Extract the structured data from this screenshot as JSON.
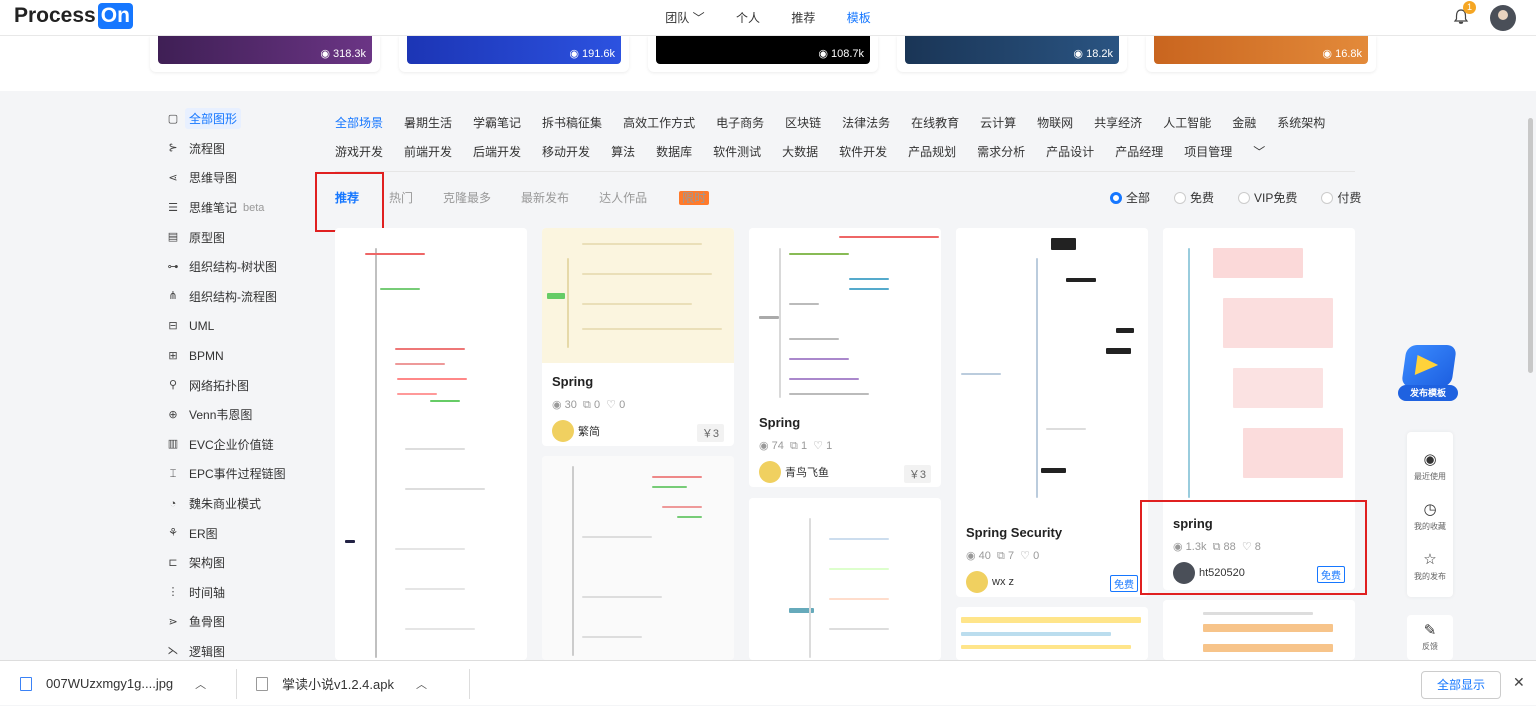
{
  "header": {
    "logo_text": "Process",
    "logo_badge": "On",
    "nav": [
      "团队 ﹀",
      "个人",
      "推荐",
      "模板"
    ],
    "notification_count": "1"
  },
  "banners": [
    {
      "views": "318.3k",
      "color": "#5a2d6e"
    },
    {
      "views": "191.6k",
      "color": "#2244cc"
    },
    {
      "views": "108.7k",
      "color": "#000000"
    },
    {
      "views": "18.2k",
      "color": "#1f3f66"
    },
    {
      "views": "16.8k",
      "color": "#d9792a"
    }
  ],
  "sidebar": {
    "items": [
      {
        "label": "全部图形",
        "icon": "all-shapes-icon",
        "glyph": "▢"
      },
      {
        "label": "流程图",
        "icon": "flowchart-icon",
        "glyph": "⊱"
      },
      {
        "label": "思维导图",
        "icon": "mindmap-icon",
        "glyph": "⋖"
      },
      {
        "label": "思维笔记",
        "icon": "notes-icon",
        "glyph": "☰",
        "extra": "beta"
      },
      {
        "label": "原型图",
        "icon": "prototype-icon",
        "glyph": "▤"
      },
      {
        "label": "组织结构-树状图",
        "icon": "org-tree-icon",
        "glyph": "⊶"
      },
      {
        "label": "组织结构-流程图",
        "icon": "org-flow-icon",
        "glyph": "⋔"
      },
      {
        "label": "UML",
        "icon": "uml-icon",
        "glyph": "⊟"
      },
      {
        "label": "BPMN",
        "icon": "bpmn-icon",
        "glyph": "⊞"
      },
      {
        "label": "网络拓扑图",
        "icon": "network-icon",
        "glyph": "⚲"
      },
      {
        "label": "Venn韦恩图",
        "icon": "venn-icon",
        "glyph": "⊕"
      },
      {
        "label": "EVC企业价值链",
        "icon": "evc-icon",
        "glyph": "▥"
      },
      {
        "label": "EPC事件过程链图",
        "icon": "epc-icon",
        "glyph": "⌶"
      },
      {
        "label": "魏朱商业模式",
        "icon": "business-model-icon",
        "glyph": "◔"
      },
      {
        "label": "ER图",
        "icon": "er-icon",
        "glyph": "⚘"
      },
      {
        "label": "架构图",
        "icon": "architecture-icon",
        "glyph": "⊏"
      },
      {
        "label": "时间轴",
        "icon": "timeline-icon",
        "glyph": "⋮"
      },
      {
        "label": "鱼骨图",
        "icon": "fishbone-icon",
        "glyph": "⋗"
      },
      {
        "label": "逻辑图",
        "icon": "logic-icon",
        "glyph": "⋋"
      }
    ]
  },
  "categories": {
    "row1": [
      "全部场景",
      "暑期生活",
      "学霸笔记",
      "拆书稿征集",
      "高效工作方式",
      "电子商务",
      "区块链",
      "法律法务",
      "在线教育",
      "云计算",
      "物联网",
      "共享经济",
      "人工智能",
      "金融",
      "系统架构"
    ],
    "row2": [
      "游戏开发",
      "前端开发",
      "后端开发",
      "移动开发",
      "算法",
      "数据库",
      "软件测试",
      "大数据",
      "软件开发",
      "产品规划",
      "需求分析",
      "产品设计",
      "产品经理",
      "项目管理",
      "﹀"
    ]
  },
  "sort_tabs": [
    "推荐",
    "热门",
    "克隆最多",
    "最新发布",
    "达人作品"
  ],
  "limited_badge": "限时",
  "filters": [
    "全部",
    "免费",
    "VIP免费",
    "付费"
  ],
  "cards": [
    {
      "title": "Spring",
      "views": "30",
      "clones": "0",
      "likes": "0",
      "author": "繁简",
      "price": "￥3"
    },
    {
      "title": "Spring",
      "views": "74",
      "clones": "1",
      "likes": "1",
      "author": "青鸟飞鱼",
      "price": "￥3"
    },
    {
      "title": "Spring Security",
      "views": "40",
      "clones": "7",
      "likes": "0",
      "author": "wx z",
      "price": "免费"
    },
    {
      "title": "spring",
      "views": "1.3k",
      "clones": "88",
      "likes": "8",
      "author": "ht520520",
      "price": "免费"
    }
  ],
  "right_tools": {
    "publish": "发布模板",
    "recent": "最近使用",
    "favorites": "我的收藏",
    "published": "我的发布",
    "feedback": "反馈"
  },
  "downloads": {
    "files": [
      "007WUzxmgy1g....jpg",
      "掌读小说v1.2.4.apk"
    ],
    "show_all": "全部显示"
  },
  "colors": {
    "accent": "#1677ff",
    "highlight_box": "#e02020"
  }
}
